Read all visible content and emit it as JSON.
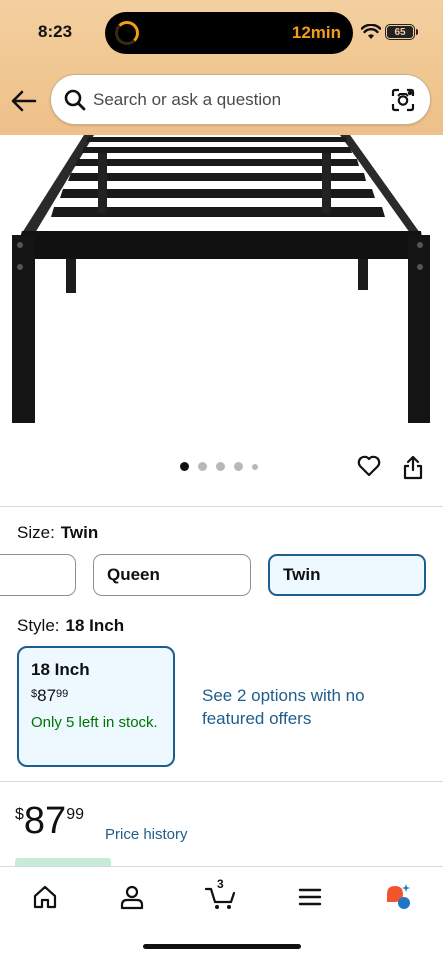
{
  "status_bar": {
    "time": "8:23",
    "timer": "12min",
    "battery": "65"
  },
  "search": {
    "placeholder": "Search or ask a question"
  },
  "carousel": {
    "total_dots": 5,
    "active_index": 0
  },
  "size": {
    "label": "Size:",
    "selected": "Twin",
    "options": [
      "",
      "Queen",
      "Twin"
    ]
  },
  "style": {
    "label": "Style:",
    "selected": "18 Inch",
    "card": {
      "title": "18 Inch",
      "currency": "$",
      "dollars": "87",
      "cents": "99",
      "stock": "Only 5 left in stock."
    },
    "options_link": "See 2 options with no featured offers"
  },
  "price": {
    "currency": "$",
    "dollars": "87",
    "cents": "99",
    "history_link": "Price history"
  },
  "bottom_nav": {
    "cart_count": "3"
  },
  "colors": {
    "header_bg": "#f3cf9f",
    "link": "#1f5d8c",
    "in_stock": "#007600",
    "selected_bg": "#edf8ff"
  }
}
